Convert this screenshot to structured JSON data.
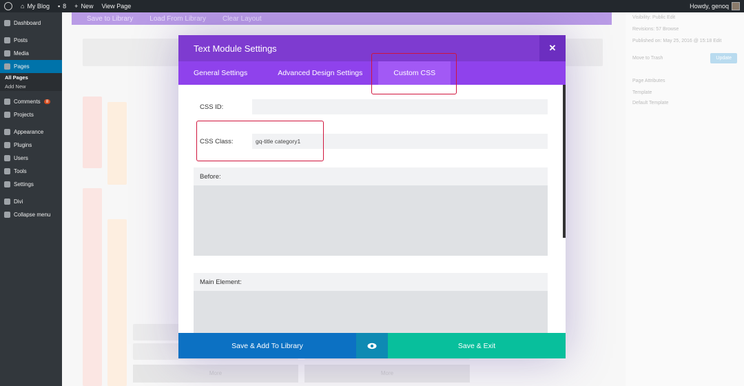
{
  "adminbar": {
    "site_name": "My Blog",
    "comments_count": "8",
    "new_label": "New",
    "view_page": "View Page",
    "greeting": "Howdy, genoq"
  },
  "sidebar": {
    "items": [
      {
        "label": "Dashboard"
      },
      {
        "label": "Posts"
      },
      {
        "label": "Media"
      },
      {
        "label": "Pages"
      },
      {
        "label": "Comments"
      },
      {
        "label": "Projects"
      },
      {
        "label": "Appearance"
      },
      {
        "label": "Plugins"
      },
      {
        "label": "Users"
      },
      {
        "label": "Tools"
      },
      {
        "label": "Settings"
      },
      {
        "label": "Divi"
      },
      {
        "label": "Collapse menu"
      }
    ],
    "sub_items": [
      "All Pages",
      "Add New"
    ],
    "comments_badge": "8"
  },
  "background": {
    "builder_buttons": [
      "Save to Library",
      "Load From Library",
      "Clear Layout"
    ],
    "more_label": "More",
    "right_panel": {
      "visibility": "Visibility: Public Edit",
      "revisions": "Revisions: 57 Browse",
      "published": "Published on: May 25, 2016 @ 15:18 Edit",
      "trash": "Move to Trash",
      "update": "Update",
      "attributes": "Page Attributes",
      "template_label": "Template",
      "template_value": "Default Template"
    }
  },
  "modal": {
    "title": "Text Module Settings",
    "close_icon": "close-icon",
    "tabs": [
      {
        "label": "General Settings"
      },
      {
        "label": "Advanced Design Settings"
      },
      {
        "label": "Custom CSS"
      }
    ],
    "fields": {
      "css_id_label": "CSS ID:",
      "css_id_value": "",
      "css_class_label": "CSS Class:",
      "css_class_value": "gq-title category1"
    },
    "blocks": [
      {
        "label": "Before:"
      },
      {
        "label": "Main Element:"
      }
    ],
    "footer": {
      "save_library": "Save & Add To Library",
      "preview_icon": "eye-icon",
      "save_exit": "Save & Exit"
    }
  },
  "colors": {
    "modal_header": "#7e3bd0",
    "tabs_bar": "#8f42ec",
    "active_tab": "#a259f5",
    "save_library_btn": "#0c71c3",
    "save_exit_btn": "#08bf9c",
    "highlight": "#d0143c"
  }
}
